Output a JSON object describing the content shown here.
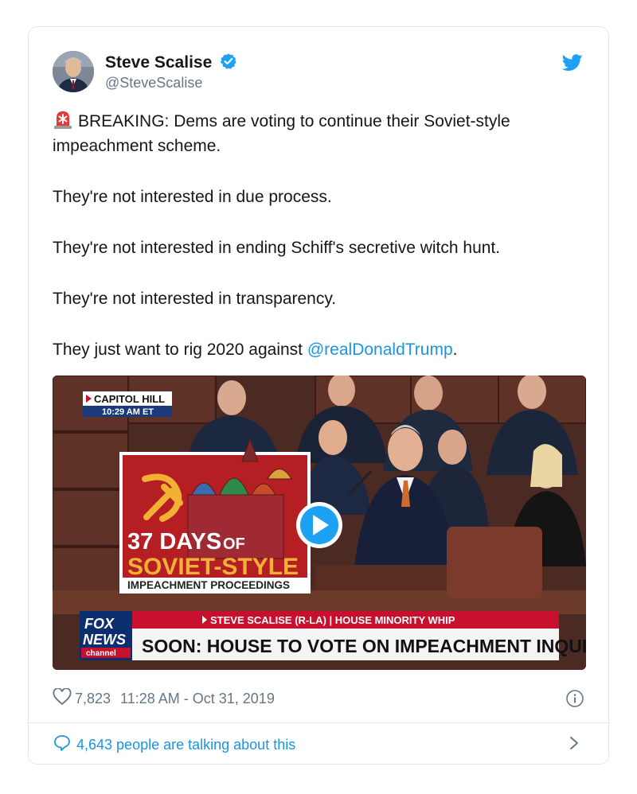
{
  "tweet": {
    "author_name": "Steve Scalise",
    "author_handle": "@SteveScalise",
    "paragraphs": [
      "BREAKING: Dems are voting to continue their Soviet-style impeachment scheme.",
      "They're not interested in due process.",
      "They're not interested in ending Schiff's secretive witch hunt.",
      "They're not interested in transparency.",
      "They just want to rig 2020 against "
    ],
    "mention": "@realDonaldTrump",
    "mention_suffix": ".",
    "likes": "7,823",
    "timestamp": "11:28 AM - Oct 31, 2019",
    "talking": "4,643 people are talking about this"
  },
  "video": {
    "location_label": "CAPITOL HILL",
    "location_time": "10:29 AM ET",
    "sign_line1_num": "37 DAYS",
    "sign_line1_word": "OF",
    "sign_line2": "SOVIET-STYLE",
    "sign_line3": "IMPEACHMENT PROCEEDINGS",
    "network_line1": "FOX",
    "network_line2": "NEWS",
    "network_line3": "channel",
    "lower_third_top": "STEVE SCALISE (R-LA) | HOUSE MINORITY WHIP",
    "lower_third_main": "SOON: HOUSE TO VOTE ON IMPEACHMENT INQUIRY"
  },
  "icons": {
    "emoji": "rotating-light-icon",
    "verified": "verified-badge-icon",
    "brand": "twitter-bird-icon",
    "like": "heart-icon",
    "info": "info-icon",
    "reply": "speech-bubble-icon",
    "more": "chevron-right-icon",
    "play": "play-icon"
  },
  "colors": {
    "accent": "#1da1f2",
    "link": "#1b95e0",
    "muted": "#657786",
    "fox_red": "#c8102e",
    "sign_red": "#b51f24",
    "sign_gold": "#f2b134"
  }
}
